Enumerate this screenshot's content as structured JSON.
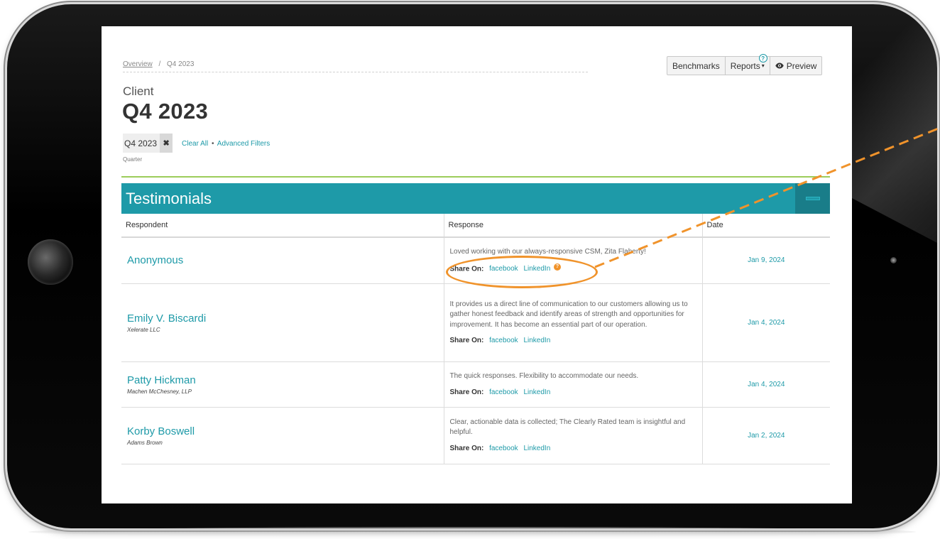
{
  "breadcrumb": {
    "overview": "Overview",
    "separator": "/",
    "current": "Q4 2023"
  },
  "toolbar": {
    "benchmarks": "Benchmarks",
    "reports": "Reports",
    "reports_caret": "▾",
    "reports_help": "?",
    "preview": "Preview",
    "preview_icon": "eye-icon"
  },
  "header": {
    "client_label": "Client",
    "title": "Q4 2023"
  },
  "filters": {
    "chip_value": "Q4 2023",
    "chip_remove": "✖",
    "clear_all": "Clear All",
    "dot": "•",
    "advanced": "Advanced Filters",
    "chip_caption": "Quarter"
  },
  "panel": {
    "title": "Testimonials"
  },
  "table": {
    "columns": [
      "Respondent",
      "Response",
      "Date"
    ],
    "share_label": "Share On:",
    "share_facebook": "facebook",
    "share_linkedin": "LinkedIn",
    "rows": [
      {
        "name": "Anonymous",
        "company": "",
        "response": "Loved working with our always-responsive CSM, Zita Flaherty!",
        "date": "Jan 9, 2024"
      },
      {
        "name": "Emily V. Biscardi",
        "company": "Xelerate LLC",
        "response": "It provides us a direct line of communication to our customers allowing us to gather honest feedback and identify areas of strength and opportunities for improvement. It has become an essential part of our operation.",
        "date": "Jan 4, 2024"
      },
      {
        "name": "Patty Hickman",
        "company": "Machen McChesney, LLP",
        "response": "The quick responses. Flexibility to accommodate our needs.",
        "date": "Jan 4, 2024"
      },
      {
        "name": "Korby Boswell",
        "company": "Adams Brown",
        "response": "Clear, actionable data is collected; The Clearly Rated team is insightful and helpful.",
        "date": "Jan 2, 2024"
      }
    ]
  },
  "annotation": {
    "badge": "?",
    "color": "#f0932b"
  },
  "colors": {
    "accent": "#1e9aa8",
    "rule": "#9ccc5a",
    "highlight": "#f0932b"
  }
}
